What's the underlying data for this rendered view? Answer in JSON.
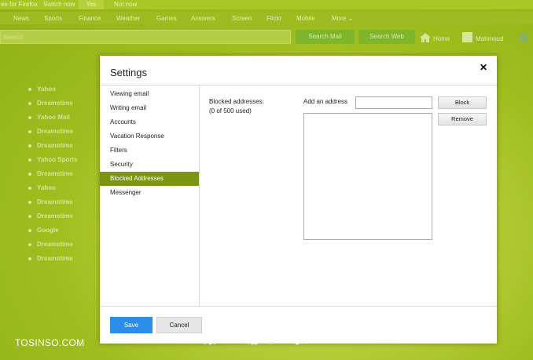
{
  "topbar": {
    "promo_text": "ee for Firefox",
    "switch_text": "Switch now",
    "yes_label": "Yes",
    "notnow_label": "Not now"
  },
  "nav": {
    "items": [
      "News",
      "Sports",
      "Finance",
      "Weather",
      "Games",
      "Answers",
      "Screen",
      "Flickr",
      "Mobile"
    ],
    "more_label": "More"
  },
  "search": {
    "placeholder": "Search",
    "search_mail_label": "Search Mail",
    "search_web_label": "Search Web",
    "home_label": "Home",
    "user_label": "Mahmoud"
  },
  "background_list": [
    "Yahoo",
    "Dreamstime",
    "Yahoo Mail",
    "Dreamstime",
    "Dreamstime",
    "Yahoo Sports",
    "Dreamstime",
    "Yahoo",
    "Dreamstime",
    "Dreamstime",
    "Google",
    "Dreamstime",
    "Dreamstime"
  ],
  "dialog": {
    "title": "Settings",
    "close_glyph": "✕",
    "menu": [
      "Viewing email",
      "Writing email",
      "Accounts",
      "Vacation Response",
      "Filters",
      "Security",
      "Blocked Addresses",
      "Messenger"
    ],
    "active_index": 6,
    "blocked_label": "Blocked addresses:",
    "blocked_count": "(0 of 500 used)",
    "add_label": "Add an address",
    "add_value": "",
    "block_button": "Block",
    "remove_button": "Remove",
    "save_button": "Save",
    "cancel_button": "Cancel"
  },
  "watermark": {
    "left": "TOSINSO.COM",
    "right": "انجمن تخصصی فناوری اطلاعات ایران - ITPro.ir"
  },
  "colors": {
    "active_menu": "#7a9611",
    "save_button": "#2b8de9",
    "background_green": "#9fbd1e"
  }
}
